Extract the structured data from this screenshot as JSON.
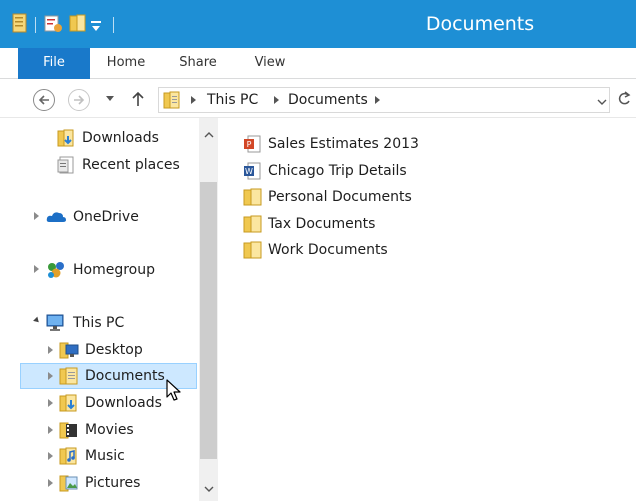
{
  "window": {
    "title": "Documents",
    "accent_color": "#1e8fd5"
  },
  "quick_access": [
    "properties-icon",
    "new-folder-icon",
    "folder-icon",
    "customize-dropdown"
  ],
  "ribbon": {
    "tabs": [
      {
        "label": "File",
        "active": true
      },
      {
        "label": "Home"
      },
      {
        "label": "Share"
      },
      {
        "label": "View"
      }
    ]
  },
  "address": {
    "crumbs": [
      "This PC",
      "Documents"
    ]
  },
  "navpane": {
    "items": [
      {
        "label": "Downloads",
        "icon": "downloads-folder-icon"
      },
      {
        "label": "Recent places",
        "icon": "recent-places-icon"
      },
      {
        "label": "OneDrive",
        "icon": "onedrive-icon"
      },
      {
        "label": "Homegroup",
        "icon": "homegroup-icon"
      },
      {
        "label": "This PC",
        "icon": "computer-icon",
        "expanded": true
      },
      {
        "label": "Desktop",
        "icon": "desktop-folder-icon"
      },
      {
        "label": "Documents",
        "icon": "documents-folder-icon",
        "selected": true
      },
      {
        "label": "Downloads",
        "icon": "downloads-folder-icon"
      },
      {
        "label": "Movies",
        "icon": "videos-folder-icon"
      },
      {
        "label": "Music",
        "icon": "music-folder-icon"
      },
      {
        "label": "Pictures",
        "icon": "pictures-folder-icon"
      }
    ]
  },
  "files": [
    {
      "name": "Sales Estimates 2013",
      "icon": "powerpoint-file-icon"
    },
    {
      "name": "Chicago Trip Details",
      "icon": "word-file-icon"
    },
    {
      "name": "Personal Documents",
      "icon": "folder-icon"
    },
    {
      "name": "Tax Documents",
      "icon": "folder-icon"
    },
    {
      "name": "Work Documents",
      "icon": "folder-icon"
    }
  ]
}
